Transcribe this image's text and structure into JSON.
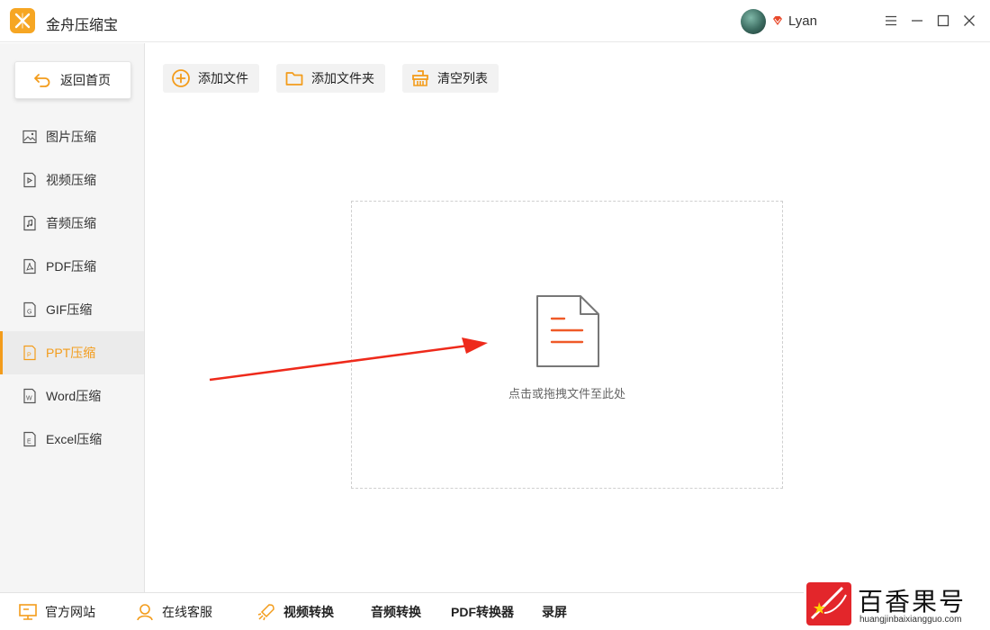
{
  "app": {
    "title": "金舟压缩宝",
    "accent": "#f39c1b"
  },
  "user": {
    "name": "Lyan"
  },
  "sidebar": {
    "back_label": "返回首页",
    "items": [
      {
        "label": "图片压缩",
        "icon": "image-icon"
      },
      {
        "label": "视频压缩",
        "icon": "video-icon"
      },
      {
        "label": "音频压缩",
        "icon": "audio-icon"
      },
      {
        "label": "PDF压缩",
        "icon": "pdf-icon"
      },
      {
        "label": "GIF压缩",
        "icon": "gif-icon"
      },
      {
        "label": "PPT压缩",
        "icon": "ppt-icon",
        "active": true
      },
      {
        "label": "Word压缩",
        "icon": "word-icon"
      },
      {
        "label": "Excel压缩",
        "icon": "excel-icon"
      }
    ]
  },
  "toolbar": {
    "add_file": "添加文件",
    "add_folder": "添加文件夹",
    "clear_list": "清空列表"
  },
  "dropzone": {
    "text": "点击或拖拽文件至此处"
  },
  "bottom": {
    "website": "官方网站",
    "support": "在线客服",
    "video_convert": "视频转换",
    "audio_convert": "音频转换",
    "pdf_convert": "PDF转换器",
    "record": "录屏"
  },
  "watermark": {
    "title": "百香果号",
    "url": "huangjinbaixiangguo.com"
  }
}
